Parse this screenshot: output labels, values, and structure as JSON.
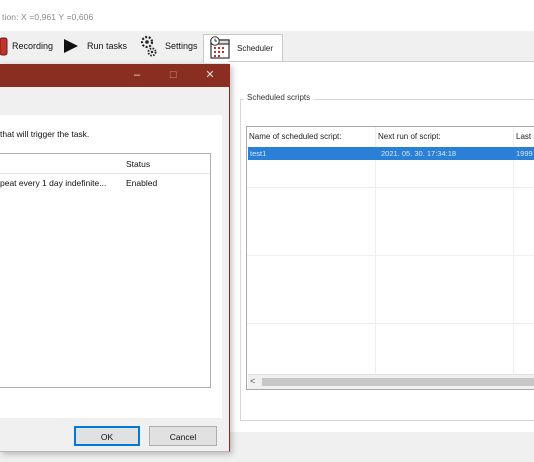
{
  "status_bar": {
    "text": "tion: X =0,961 Y =0,606"
  },
  "toolbar": {
    "recording_label": "Recording",
    "run_tasks_label": "Run tasks",
    "settings_label": "Settings",
    "scheduler_label": "Scheduler"
  },
  "scheduler": {
    "group_label": "Scheduled scripts",
    "columns": [
      "Name of scheduled script:",
      "Next run of script:",
      "Last r"
    ],
    "rows": [
      [
        "test1",
        "2021. 05. 30. 17:34:18",
        "1999"
      ]
    ],
    "scroll_left_glyph": "<"
  },
  "dialog": {
    "minimize_glyph": "–",
    "maximize_glyph": "☐",
    "close_glyph": "✕",
    "instruction": "that will trigger the task.",
    "status_header": "Status",
    "trigger_rows": [
      {
        "details": "peat every 1 day indefinite...",
        "status": "Enabled"
      }
    ],
    "ok_label": "OK",
    "cancel_label": "Cancel"
  },
  "colors": {
    "dialog_title": "#8b2e22",
    "selection": "#2a7fd6"
  }
}
